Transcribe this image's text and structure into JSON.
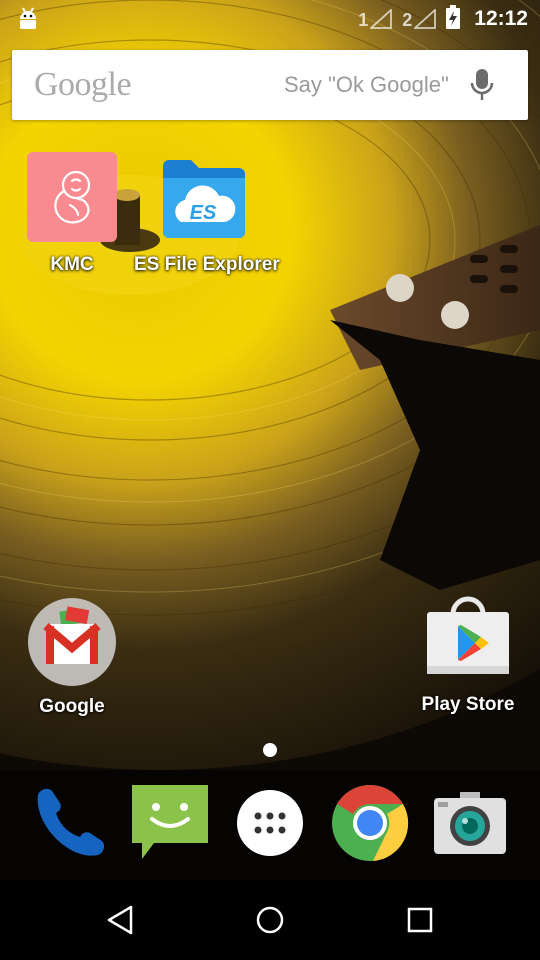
{
  "status_bar": {
    "sim1": "1",
    "sim2": "2",
    "time": "12:12",
    "icons": [
      "android-icon",
      "signal-1-icon",
      "signal-2-icon",
      "battery-charging-icon"
    ]
  },
  "search": {
    "logo": "Google",
    "hint": "Say \"Ok Google\"",
    "icon": "mic-icon"
  },
  "home_apps": [
    {
      "label": "KMC",
      "icon": "fetus-icon"
    },
    {
      "label": "ES File Explorer",
      "icon": "es-folder-icon"
    },
    {
      "label": "Google",
      "icon": "gmail-folder-icon"
    },
    {
      "label": "Play Store",
      "icon": "play-store-icon"
    }
  ],
  "dock": [
    {
      "name": "phone",
      "icon": "phone-icon"
    },
    {
      "name": "messaging",
      "icon": "message-icon"
    },
    {
      "name": "all-apps",
      "icon": "app-drawer-icon"
    },
    {
      "name": "chrome",
      "icon": "chrome-icon"
    },
    {
      "name": "camera",
      "icon": "camera-icon"
    }
  ],
  "nav": {
    "back": "back-icon",
    "home": "home-icon",
    "recents": "recents-icon"
  },
  "colors": {
    "kmc_bg": "#f98a90",
    "es_blue": "#2d9fe8",
    "vinyl_yellow": "#f4d000",
    "nav_bg": "#000000"
  }
}
